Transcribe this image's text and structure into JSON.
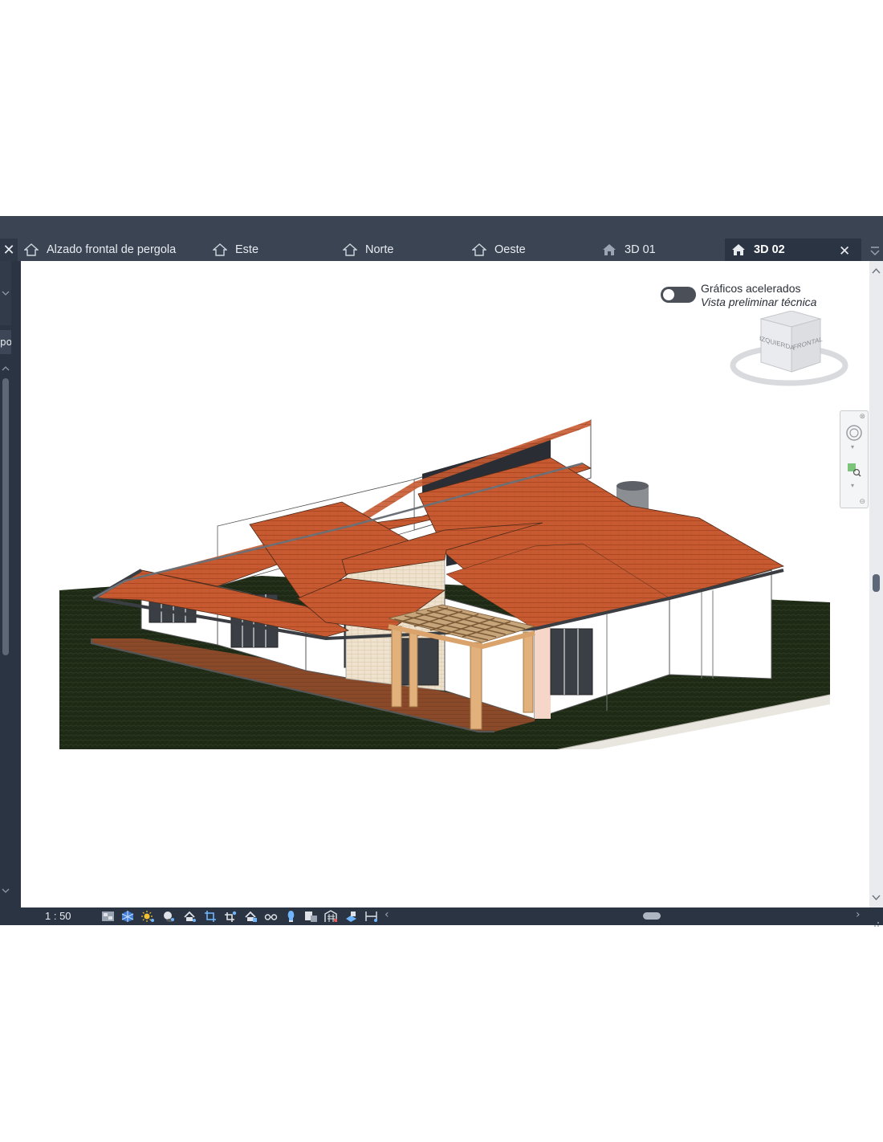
{
  "tabs": [
    {
      "label": "Alzado frontal de pergola",
      "icon": "elevation-view-icon"
    },
    {
      "label": "Este",
      "icon": "elevation-view-icon"
    },
    {
      "label": "Norte",
      "icon": "elevation-view-icon"
    },
    {
      "label": "Oeste",
      "icon": "elevation-view-icon"
    },
    {
      "label": "3D 01",
      "icon": "3d-view-icon"
    },
    {
      "label": "3D 02",
      "icon": "3d-view-icon",
      "active": true
    }
  ],
  "viewport": {
    "toggle_label": "Gráficos acelerados",
    "mode_label": "Vista preliminar técnica",
    "viewcube": {
      "left_face": "IZQUIERDA",
      "front_face": "FRONTAL"
    }
  },
  "left_panel": {
    "partial_label": "po"
  },
  "statusbar": {
    "scale": "1 : 50"
  },
  "colors": {
    "chrome_dark": "#2b3442",
    "chrome_tab": "#3b4453",
    "roof": "#c85a32",
    "wall": "#ffffff",
    "grass": "#1e2a16",
    "deck": "#8a4a2a",
    "pergola": "#e2b07a"
  }
}
